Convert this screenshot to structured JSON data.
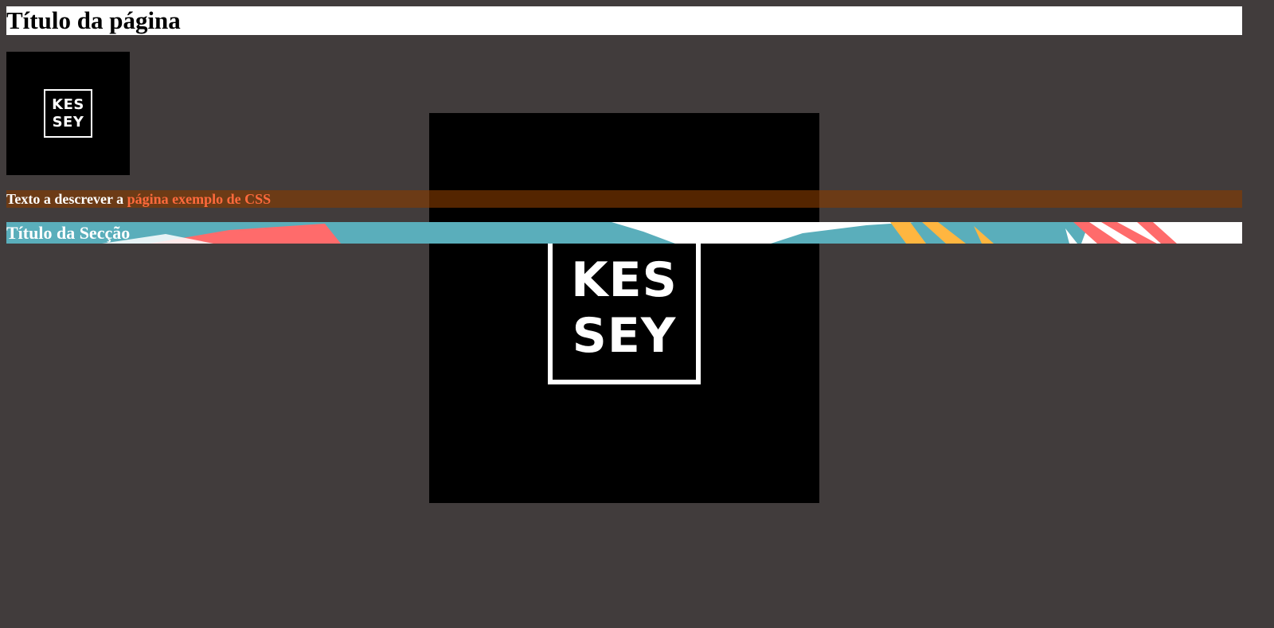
{
  "page": {
    "title": "Título da página",
    "background_color": "#413c3c"
  },
  "logo": {
    "line1": "KES",
    "line2": "SEY"
  },
  "description": {
    "text_before": "Texto a descrever a ",
    "highlight": "página exemplo de CSS",
    "highlight_color": "#ff6a3c"
  },
  "section": {
    "title": "Título da Secção",
    "banner_colors": [
      "#5aaebb",
      "#ff6b6b",
      "#ffb640",
      "#ffffff"
    ]
  }
}
